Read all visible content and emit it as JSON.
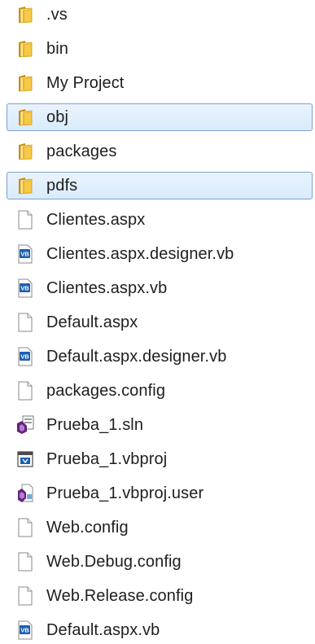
{
  "explorer": {
    "items": [
      {
        "name": ".vs",
        "icon": "folder-icon",
        "type": "folder",
        "selected": false
      },
      {
        "name": "bin",
        "icon": "folder-icon",
        "type": "folder",
        "selected": false
      },
      {
        "name": "My Project",
        "icon": "folder-icon",
        "type": "folder",
        "selected": false
      },
      {
        "name": "obj",
        "icon": "folder-icon",
        "type": "folder",
        "selected": true
      },
      {
        "name": "packages",
        "icon": "folder-icon",
        "type": "folder",
        "selected": false
      },
      {
        "name": "pdfs",
        "icon": "folder-icon",
        "type": "folder",
        "selected": true
      },
      {
        "name": "Clientes.aspx",
        "icon": "blank-file-icon",
        "type": "file",
        "selected": false
      },
      {
        "name": "Clientes.aspx.designer.vb",
        "icon": "vb-file-icon",
        "type": "file",
        "selected": false
      },
      {
        "name": "Clientes.aspx.vb",
        "icon": "vb-file-icon",
        "type": "file",
        "selected": false
      },
      {
        "name": "Default.aspx",
        "icon": "blank-file-icon",
        "type": "file",
        "selected": false
      },
      {
        "name": "Default.aspx.designer.vb",
        "icon": "vb-file-icon",
        "type": "file",
        "selected": false
      },
      {
        "name": "packages.config",
        "icon": "blank-file-icon",
        "type": "file",
        "selected": false
      },
      {
        "name": "Prueba_1.sln",
        "icon": "solution-file-icon",
        "type": "file",
        "selected": false
      },
      {
        "name": "Prueba_1.vbproj",
        "icon": "vbproj-file-icon",
        "type": "file",
        "selected": false
      },
      {
        "name": "Prueba_1.vbproj.user",
        "icon": "vbproj-user-file-icon",
        "type": "file",
        "selected": false
      },
      {
        "name": "Web.config",
        "icon": "blank-file-icon",
        "type": "file",
        "selected": false
      },
      {
        "name": "Web.Debug.config",
        "icon": "blank-file-icon",
        "type": "file",
        "selected": false
      },
      {
        "name": "Web.Release.config",
        "icon": "blank-file-icon",
        "type": "file",
        "selected": false
      },
      {
        "name": "Default.aspx.vb",
        "icon": "vb-file-icon",
        "type": "file",
        "selected": false
      }
    ]
  },
  "colors": {
    "folder": "#e8b423",
    "selection_fill": "#d9ebfc",
    "selection_border": "#7da2ce",
    "vb_badge": "#1c5fb0",
    "vs_purple": "#68217a"
  }
}
